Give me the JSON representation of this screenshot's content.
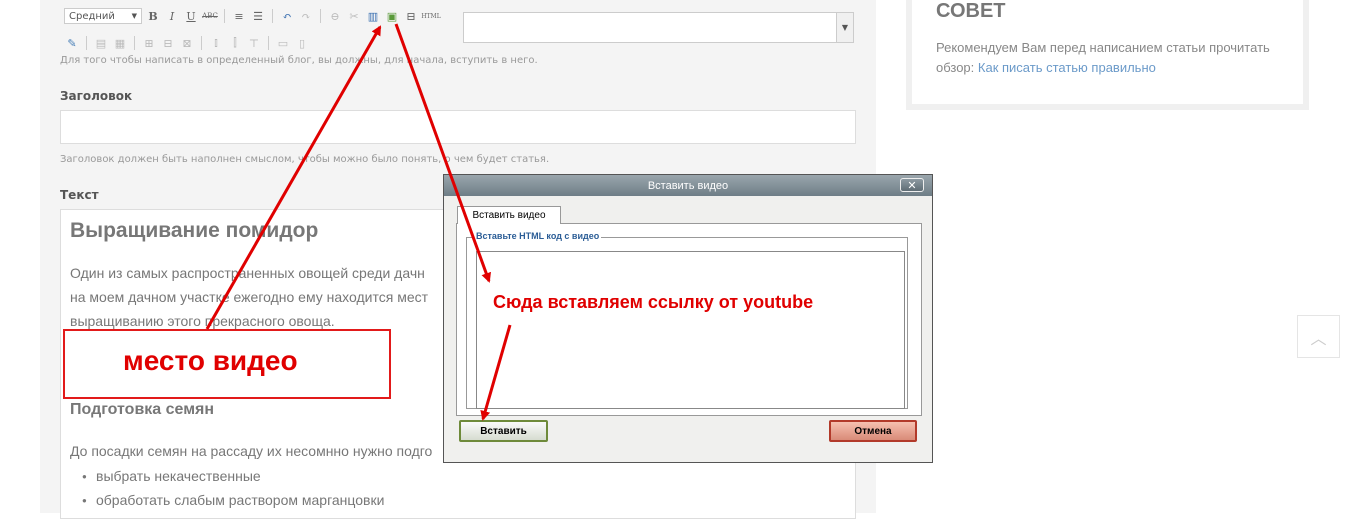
{
  "toolbar": {
    "font_size_value": "Средний",
    "bold": "B",
    "italic": "I",
    "underline": "U",
    "strike": "ABC",
    "html_label": "HTML"
  },
  "blog_hint": "Для того чтобы написать в определенный блог, вы должны, для начала, вступить в него.",
  "title_field": {
    "label": "Заголовок",
    "hint": "Заголовок должен быть наполнен смыслом, чтобы можно было понять, о чем будет статья."
  },
  "text_field": {
    "label": "Текст",
    "heading": "Выращивание помидор",
    "para1_line1": "Один из самых распространенных овощей среди дачн",
    "para1_line2": "на моем дачном участке ежегодно ему находится мест",
    "para1_line3": "выращиванию этого прекрасного овоща.",
    "subheading": "Подготовка семян",
    "para2": "До посадки семян на рассаду их несомнно нужно подго",
    "list_items": [
      "выбрать некачественные",
      "обработать слабым раствором марганцовки"
    ]
  },
  "annotations": {
    "video_place": "место видео",
    "paste_link": "Сюда вставляем ссылку от youtube",
    "color": "#e00000"
  },
  "sidebar": {
    "title": "СОВЕТ",
    "text": "Рекомендуем Вам перед написанием статьи прочитать обзор: ",
    "link": "Как писать статью правильно"
  },
  "dialog": {
    "title": "Вставить видео",
    "close": "✕",
    "tab": "Вставить видео",
    "legend": "Вставьте HTML код с видео",
    "textarea_value": "",
    "insert_button": "Вставить",
    "cancel_button": "Отмена"
  },
  "icons": {
    "scroll_top": "chevron-up-icon"
  }
}
